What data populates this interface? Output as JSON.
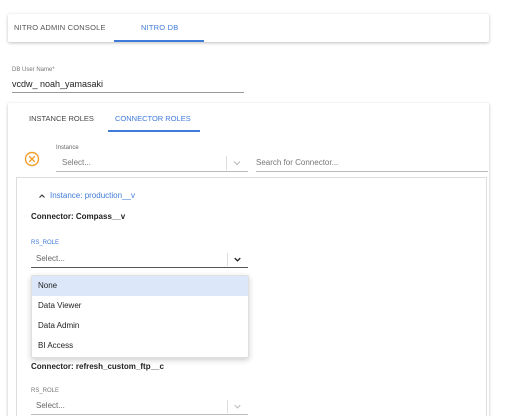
{
  "top_tabs": [
    {
      "label": "NITRO ADMIN CONSOLE",
      "active": false
    },
    {
      "label": "NITRO DB",
      "active": true
    }
  ],
  "user_field": {
    "label": "DB User Name*",
    "value": "vcdw_ noah_yamasaki"
  },
  "sub_tabs": [
    {
      "label": "INSTANCE ROLES",
      "active": false
    },
    {
      "label": "CONNECTOR ROLES",
      "active": true
    }
  ],
  "filters": {
    "instance_label": "Instance",
    "instance_placeholder": "Select...",
    "search_placeholder": "Search for Connector..."
  },
  "instance_group": {
    "label": "Instance: production__v",
    "expanded": true
  },
  "connectors": [
    {
      "title": "Connector: Compass__v",
      "role_label": "RS_ROLE",
      "role_placeholder": "Select...",
      "open": true
    },
    {
      "title": "Connector: refresh_custom_ftp__c",
      "role_label": "RS_ROLE",
      "role_placeholder": "Select...",
      "open": false
    }
  ],
  "role_options": [
    "None",
    "Data Viewer",
    "Data Admin",
    "BI Access"
  ],
  "highlighted_option": "None",
  "colors": {
    "accent": "#3f7bd9",
    "clear_icon": "#f0a030",
    "highlight": "#dce8fa"
  }
}
